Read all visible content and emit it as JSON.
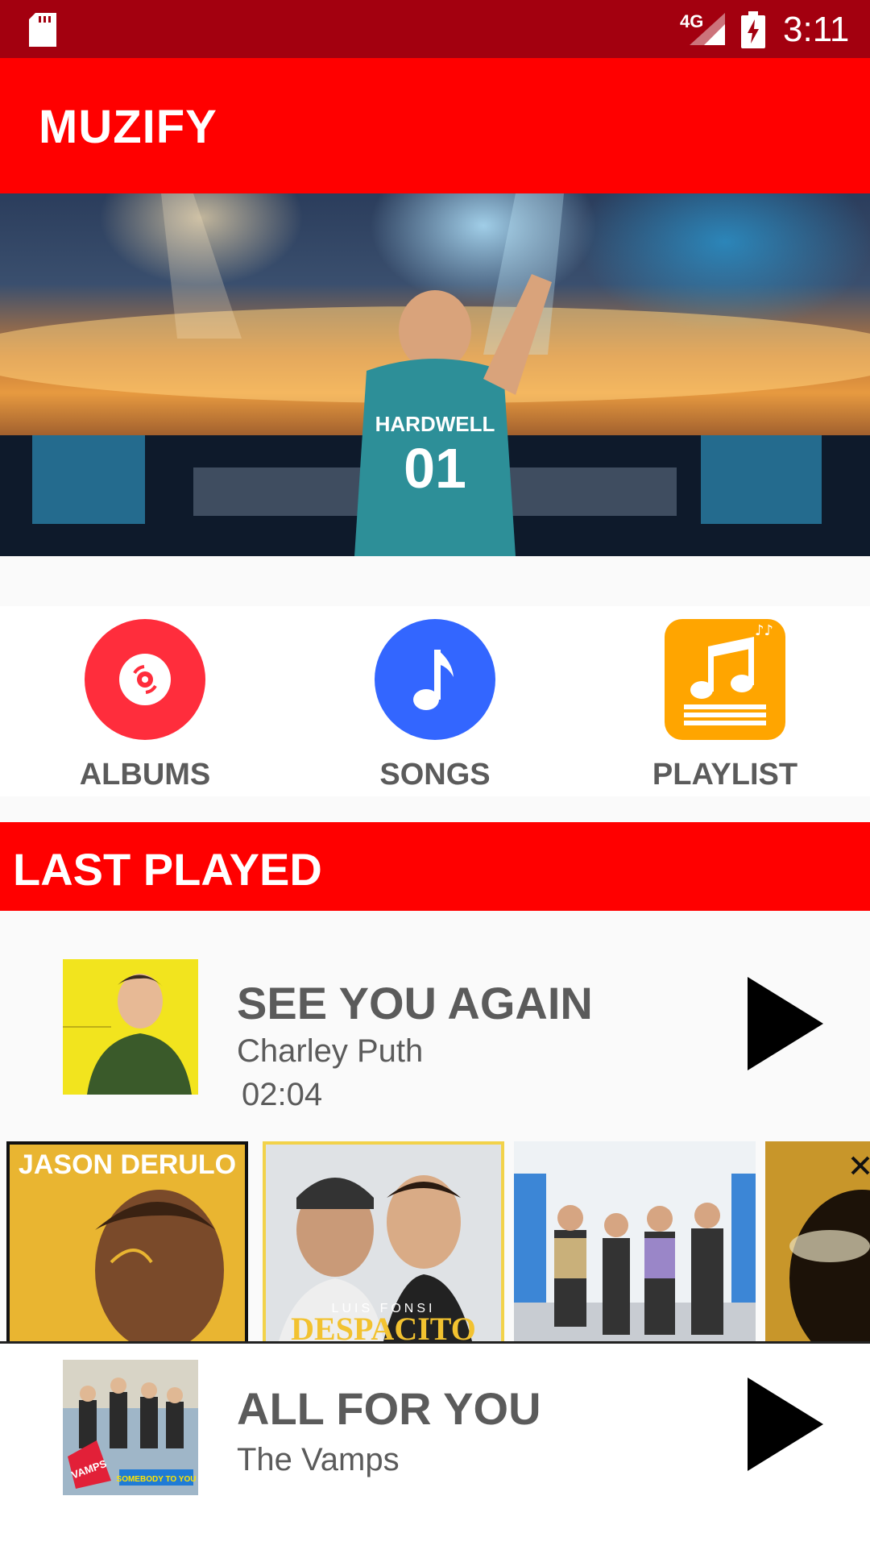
{
  "status_bar": {
    "network": "4G",
    "time": "3:11"
  },
  "app_bar": {
    "title": "MUZIFY"
  },
  "hero": {
    "jersey_name": "HARDWELL",
    "jersey_number": "01"
  },
  "categories": [
    {
      "label": "ALBUMS",
      "icon": "album-disc-icon",
      "color": "#ff2d3c"
    },
    {
      "label": "SONGS",
      "icon": "music-note-icon",
      "color": "#3366ff"
    },
    {
      "label": "PLAYLIST",
      "icon": "playlist-icon",
      "color": "#ffa500"
    }
  ],
  "last_played": {
    "header": "LAST PLAYED",
    "track": {
      "title": "SEE YOU AGAIN",
      "artist": "Charley Puth",
      "duration": "02:04"
    }
  },
  "albums": [
    {
      "title_text": "JASON DERULO"
    },
    {
      "artist_text": "LUIS FONSI",
      "title_text": "DESPACITO"
    },
    {
      "title_text": ""
    },
    {
      "title_text": ""
    }
  ],
  "now_playing": {
    "title": "ALL FOR YOU",
    "artist": "The Vamps",
    "cover_text": "SOMEBODY TO YOU",
    "cover_brand": "VAMPS"
  },
  "colors": {
    "accent": "#ff0000",
    "status_bar": "#a3000f",
    "text_gray": "#5b5b5b"
  }
}
